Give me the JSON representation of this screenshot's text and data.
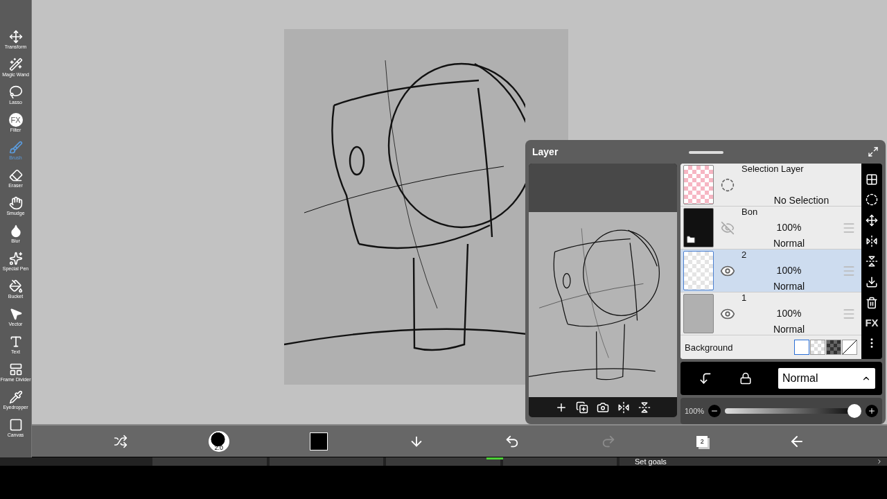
{
  "tools": [
    {
      "kind": "transform",
      "label": "Transform",
      "selected": false
    },
    {
      "kind": "wand",
      "label": "Magic Wand",
      "selected": false
    },
    {
      "kind": "lasso",
      "label": "Lasso",
      "selected": false
    },
    {
      "kind": "filter",
      "label": "Filter",
      "glyph": "FX",
      "selected": false
    },
    {
      "kind": "brush",
      "label": "Brush",
      "selected": true
    },
    {
      "kind": "eraser",
      "label": "Eraser",
      "selected": false
    },
    {
      "kind": "smudge",
      "label": "Smudge",
      "selected": false
    },
    {
      "kind": "blur",
      "label": "Blur",
      "selected": false
    },
    {
      "kind": "special",
      "label": "Special Pen",
      "selected": false
    },
    {
      "kind": "bucket",
      "label": "Bucket",
      "selected": false
    },
    {
      "kind": "vector",
      "label": "Vector",
      "selected": false
    },
    {
      "kind": "text",
      "label": "Text",
      "selected": false
    },
    {
      "kind": "frame",
      "label": "Frame Divider",
      "selected": false
    },
    {
      "kind": "eyedropper",
      "label": "Eyedropper",
      "selected": false
    },
    {
      "kind": "canvas",
      "label": "Canvas",
      "selected": false
    }
  ],
  "layer_panel": {
    "title": "Layer",
    "selection_layer": {
      "name": "Selection Layer",
      "status": "No Selection"
    },
    "layers": [
      {
        "kind": "folder",
        "name": "Bon",
        "opacity": "100%",
        "blend": "Normal",
        "visible": false,
        "selected": false
      },
      {
        "kind": "sketch",
        "name": "2",
        "opacity": "100%",
        "blend": "Normal",
        "visible": true,
        "selected": true
      },
      {
        "kind": "fill",
        "name": "1",
        "opacity": "100%",
        "blend": "Normal",
        "visible": true,
        "selected": false
      }
    ],
    "background": {
      "label": "Background",
      "swatches": [
        {
          "kind": "white",
          "selected": true
        },
        {
          "kind": "light",
          "selected": false
        },
        {
          "kind": "dark",
          "selected": false
        },
        {
          "kind": "none",
          "selected": false
        }
      ]
    },
    "side_fx": "FX",
    "blend_mode": "Normal",
    "opacity": {
      "reading": "100%",
      "level": 1
    }
  },
  "bottom_bar": {
    "brush_size": "2.0",
    "layer_count": "2",
    "undo_disabled": false,
    "redo_disabled": true
  },
  "taskbar": {
    "label": "Set goals"
  }
}
